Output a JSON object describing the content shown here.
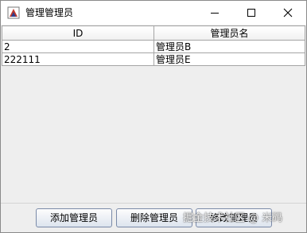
{
  "window": {
    "title": "管理管理员"
  },
  "table": {
    "columns": [
      "ID",
      "管理员名"
    ],
    "rows": [
      [
        "2",
        "管理员B"
      ],
      [
        "222111",
        "管理员E"
      ]
    ]
  },
  "buttons": {
    "add_label": "添加管理员",
    "delete_label": "删除管理员",
    "modify_label": "修改管理员"
  },
  "watermark": {
    "text": "掘金技术社区 @ 米码"
  }
}
